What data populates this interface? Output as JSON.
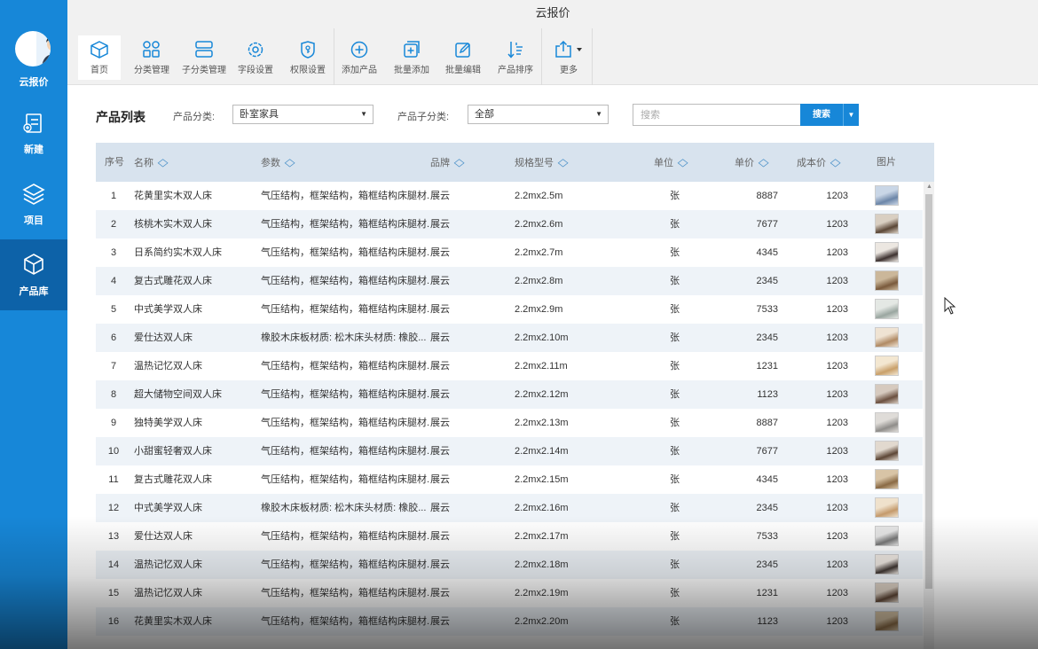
{
  "app": {
    "title": "云报价"
  },
  "sidebar": {
    "user_label": "云报价",
    "items": [
      {
        "label": "新建",
        "icon": "new-quote-icon"
      },
      {
        "label": "项目",
        "icon": "layers-icon"
      },
      {
        "label": "产品库",
        "icon": "cube-icon"
      }
    ],
    "active": "产品库"
  },
  "toolbar": {
    "items": [
      {
        "label": "首页",
        "icon": "box-icon"
      },
      {
        "label": "分类管理",
        "icon": "grid-icon"
      },
      {
        "label": "子分类管理",
        "icon": "rows-icon"
      },
      {
        "label": "字段设置",
        "icon": "gear-icon"
      },
      {
        "label": "权限设置",
        "icon": "permission-icon"
      },
      {
        "label": "添加产品",
        "icon": "plus-circle-icon"
      },
      {
        "label": "批量添加",
        "icon": "batch-add-icon"
      },
      {
        "label": "批量编辑",
        "icon": "edit-icon"
      },
      {
        "label": "产品排序",
        "icon": "sort-icon"
      },
      {
        "label": "更多",
        "icon": "share-icon"
      }
    ]
  },
  "filters": {
    "page_title": "产品列表",
    "category_label": "产品分类:",
    "category_value": "卧室家具",
    "subcategory_label": "产品子分类:",
    "subcategory_value": "全部",
    "search_placeholder": "搜索",
    "search_button": "搜索"
  },
  "table": {
    "columns": [
      "序号",
      "名称",
      "参数",
      "品牌",
      "规格型号",
      "单位",
      "单价",
      "成本价",
      "图片"
    ],
    "rows": [
      {
        "no": "1",
        "name": "花黄里实木双人床",
        "params": "气压结构，框架结构，箱框结构床腿材...",
        "brand": "展云",
        "spec": "2.2mx2.5m",
        "unit": "张",
        "price": "8887",
        "cost": "1203"
      },
      {
        "no": "2",
        "name": "核桃木实木双人床",
        "params": "气压结构，框架结构，箱框结构床腿材...",
        "brand": "展云",
        "spec": "2.2mx2.6m",
        "unit": "张",
        "price": "7677",
        "cost": "1203"
      },
      {
        "no": "3",
        "name": "日系简约实木双人床",
        "params": "气压结构，框架结构，箱框结构床腿材...",
        "brand": "展云",
        "spec": "2.2mx2.7m",
        "unit": "张",
        "price": "4345",
        "cost": "1203"
      },
      {
        "no": "4",
        "name": "复古式雕花双人床",
        "params": "气压结构，框架结构，箱框结构床腿材...",
        "brand": "展云",
        "spec": "2.2mx2.8m",
        "unit": "张",
        "price": "2345",
        "cost": "1203"
      },
      {
        "no": "5",
        "name": "中式美学双人床",
        "params": "气压结构，框架结构，箱框结构床腿材...",
        "brand": "展云",
        "spec": "2.2mx2.9m",
        "unit": "张",
        "price": "7533",
        "cost": "1203"
      },
      {
        "no": "6",
        "name": "爱仕达双人床",
        "params": "橡胶木床板材质: 松木床头材质: 橡胶...",
        "brand": "展云",
        "spec": "2.2mx2.10m",
        "unit": "张",
        "price": "2345",
        "cost": "1203"
      },
      {
        "no": "7",
        "name": "温热记忆双人床",
        "params": "气压结构，框架结构，箱框结构床腿材...",
        "brand": "展云",
        "spec": "2.2mx2.11m",
        "unit": "张",
        "price": "1231",
        "cost": "1203"
      },
      {
        "no": "8",
        "name": "超大储物空间双人床",
        "params": "气压结构，框架结构，箱框结构床腿材...",
        "brand": "展云",
        "spec": "2.2mx2.12m",
        "unit": "张",
        "price": "1123",
        "cost": "1203"
      },
      {
        "no": "9",
        "name": "独特美学双人床",
        "params": "气压结构，框架结构，箱框结构床腿材...",
        "brand": "展云",
        "spec": "2.2mx2.13m",
        "unit": "张",
        "price": "8887",
        "cost": "1203"
      },
      {
        "no": "10",
        "name": "小甜蜜轻奢双人床",
        "params": "气压结构，框架结构，箱框结构床腿材...",
        "brand": "展云",
        "spec": "2.2mx2.14m",
        "unit": "张",
        "price": "7677",
        "cost": "1203"
      },
      {
        "no": "11",
        "name": "复古式雕花双人床",
        "params": "气压结构，框架结构，箱框结构床腿材...",
        "brand": "展云",
        "spec": "2.2mx2.15m",
        "unit": "张",
        "price": "4345",
        "cost": "1203"
      },
      {
        "no": "12",
        "name": "中式美学双人床",
        "params": "橡胶木床板材质: 松木床头材质: 橡胶...",
        "brand": "展云",
        "spec": "2.2mx2.16m",
        "unit": "张",
        "price": "2345",
        "cost": "1203"
      },
      {
        "no": "13",
        "name": "爱仕达双人床",
        "params": "气压结构，框架结构，箱框结构床腿材...",
        "brand": "展云",
        "spec": "2.2mx2.17m",
        "unit": "张",
        "price": "7533",
        "cost": "1203"
      },
      {
        "no": "14",
        "name": "温热记忆双人床",
        "params": "气压结构，框架结构，箱框结构床腿材...",
        "brand": "展云",
        "spec": "2.2mx2.18m",
        "unit": "张",
        "price": "2345",
        "cost": "1203"
      },
      {
        "no": "15",
        "name": "温热记忆双人床",
        "params": "气压结构，框架结构，箱框结构床腿材...",
        "brand": "展云",
        "spec": "2.2mx2.19m",
        "unit": "张",
        "price": "1231",
        "cost": "1203"
      },
      {
        "no": "16",
        "name": "花黄里实木双人床",
        "params": "气压结构，框架结构，箱框结构床腿材...",
        "brand": "展云",
        "spec": "2.2mx2.20m",
        "unit": "张",
        "price": "1123",
        "cost": "1203"
      }
    ]
  },
  "colors": {
    "primary": "#1787d8",
    "sidebar_active": "#0d62a8",
    "header_bg": "#d8e3ee",
    "row_alt": "#eef3f8"
  }
}
